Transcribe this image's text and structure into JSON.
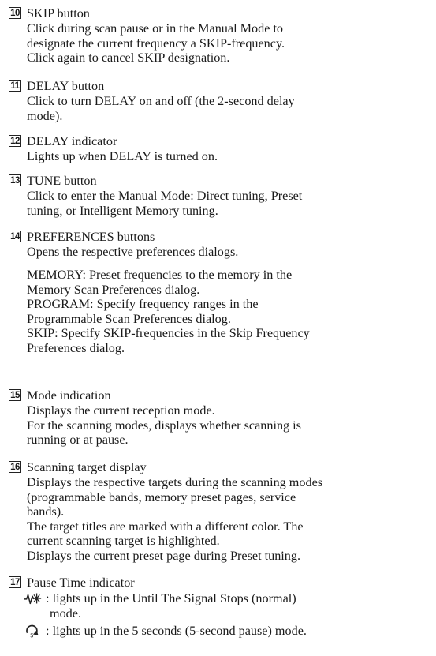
{
  "entries": [
    {
      "number": "10",
      "title": "SKIP button",
      "lines": [
        "Click during scan pause or in the Manual Mode to",
        "designate the current frequency a SKIP-frequency.",
        "Click again to cancel SKIP designation."
      ]
    },
    {
      "number": "11",
      "title": "DELAY button",
      "lines": [
        "Click to turn DELAY on and off (the 2-second delay",
        "mode)."
      ]
    },
    {
      "number": "12",
      "title": "DELAY indicator",
      "lines": [
        "Lights up when DELAY is turned on."
      ]
    },
    {
      "number": "13",
      "title": "TUNE button",
      "lines": [
        "Click to enter the Manual Mode: Direct tuning, Preset",
        "tuning, or Intelligent Memory tuning."
      ]
    },
    {
      "number": "14",
      "title": "PREFERENCES buttons",
      "lines": [
        "Opens the respective preferences dialogs."
      ],
      "sublines": [
        "MEMORY: Preset frequencies to the memory in the",
        "Memory Scan Preferences dialog.",
        "PROGRAM: Specify frequency ranges in the",
        "Programmable Scan Preferences dialog.",
        "SKIP: Specify SKIP-frequencies in the Skip Frequency",
        "Preferences dialog."
      ]
    },
    {
      "number": "15",
      "title": "Mode indication",
      "lines": [
        "Displays the current reception mode.",
        "For the scanning modes, displays whether scanning is",
        "running or at pause."
      ]
    },
    {
      "number": "16",
      "title": "Scanning target display",
      "lines": [
        "Displays the respective targets during the scanning modes",
        "(programmable bands, memory preset pages, service",
        "bands).",
        "The target titles are marked with a different color. The",
        "current scanning target is highlighted.",
        "Displays the current preset page during Preset tuning."
      ]
    },
    {
      "number": "17",
      "title": "Pause Time indicator",
      "icon_items": [
        {
          "icon": "signal-wave-icon",
          "text": ": lights up in the Until The Signal Stops (normal)",
          "continuation": "mode."
        },
        {
          "icon": "five-second-arrow-icon",
          "icon_label": "5",
          "text": ": lights up in the 5 seconds (5-second pause) mode."
        }
      ]
    }
  ]
}
